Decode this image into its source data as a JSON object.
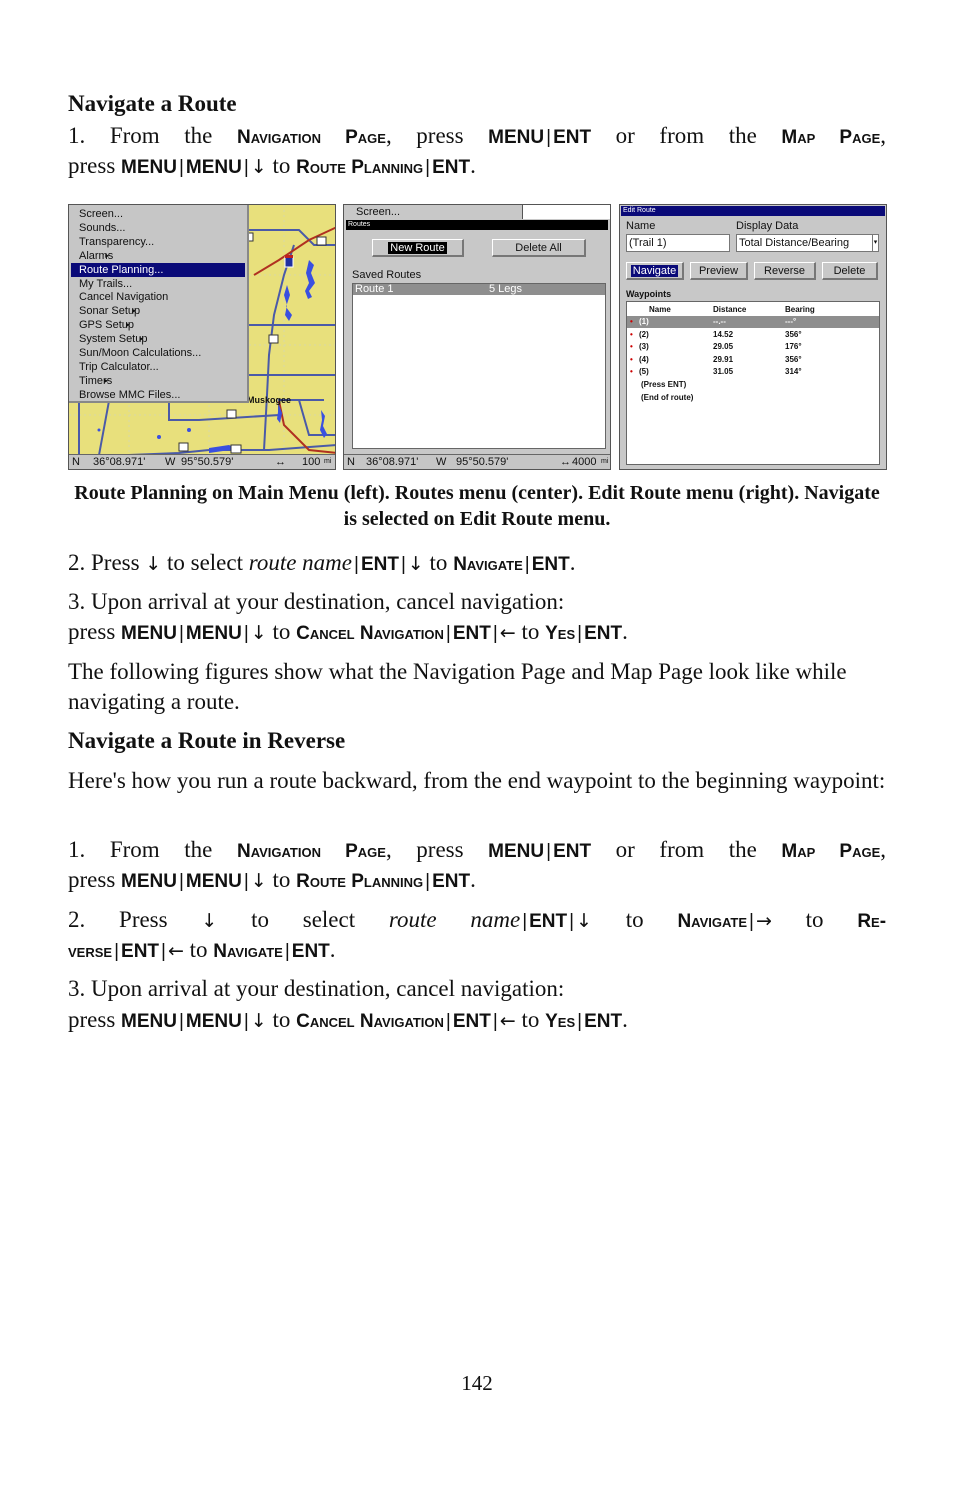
{
  "section1": {
    "heading": "Navigate a Route",
    "step1": {
      "num": "1. From the",
      "navpage": "Navigation Page",
      "press": ", press",
      "menu": "MENU",
      "ent": "ENT",
      "or": "or from the",
      "mappage": "Map Page",
      "comma": ",",
      "press2": "press",
      "to": "to",
      "routeplanning": "Route Planning"
    },
    "step2": {
      "num": "2. Press",
      "to_select": "to select",
      "route_name": "route name",
      "to": "to",
      "navigate": "Navigate",
      "ent": "ENT"
    },
    "step3": {
      "line1": "3. Upon arrival at your destination, cancel navigation:",
      "press": "press",
      "menu": "MENU",
      "to": "to",
      "cancel": "Cancel Navigation",
      "ent": "ENT",
      "yes": "Yes"
    },
    "following": "The following figures show what the Navigation Page and Map Page look like while navigating a route."
  },
  "caption": "Route Planning on Main Menu (left). Routes menu (center). Edit Route menu (right). Navigate is selected on Edit Route menu.",
  "section2": {
    "heading": "Navigate a Route in Reverse",
    "intro": "Here's how you run a route backward, from the end waypoint to the beginning waypoint:",
    "step2": {
      "num": "2. Press",
      "to_select": "to select",
      "route_name": "route name",
      "to": "to",
      "navigate": "Navigate",
      "reverse_a": "Re-",
      "reverse_b": "verse",
      "ent": "ENT"
    }
  },
  "keys": {
    "down": "↓",
    "left": "←",
    "right": "→",
    "sep": "|",
    "period": "."
  },
  "screen1": {
    "menu_items": [
      {
        "label": "Screen...",
        "submenu": false
      },
      {
        "label": "Sounds...",
        "submenu": false
      },
      {
        "label": "Transparency...",
        "submenu": false
      },
      {
        "label": "Alarms",
        "submenu": true
      },
      {
        "label": "Route Planning...",
        "submenu": false,
        "selected": true
      },
      {
        "label": "My Trails...",
        "submenu": false
      },
      {
        "label": "Cancel Navigation",
        "submenu": false
      },
      {
        "label": "Sonar Setup",
        "submenu": true
      },
      {
        "label": "GPS Setup",
        "submenu": true
      },
      {
        "label": "System Setup",
        "submenu": true
      },
      {
        "label": "Sun/Moon Calculations...",
        "submenu": false
      },
      {
        "label": "Trip Calculator...",
        "submenu": false
      },
      {
        "label": "Timers",
        "submenu": true
      },
      {
        "label": "Browse MMC Files...",
        "submenu": false
      }
    ],
    "town": "Muskogee",
    "status": {
      "n": "N",
      "lat": "36°08.971'",
      "w": "W",
      "lon": "95°50.579'",
      "zoom_icon": "↔",
      "zoom": "100",
      "unit": "mi"
    }
  },
  "screen2": {
    "top": "Screen...",
    "title": "Routes",
    "new_route": "New Route",
    "delete_all": "Delete All",
    "saved_label": "Saved Routes",
    "routes": [
      {
        "name": "Route 1",
        "legs": "5 Legs"
      }
    ],
    "status": {
      "n": "N",
      "lat": "36°08.971'",
      "w": "W",
      "lon": "95°50.579'",
      "zoom_icon": "↔",
      "zoom": "4000",
      "unit": "mi"
    }
  },
  "screen3": {
    "title": "Edit Route",
    "name_label": "Name",
    "name_value": "(Trail 1)",
    "display_label": "Display Data",
    "display_value": "Total Distance/Bearing",
    "buttons": {
      "navigate": "Navigate",
      "preview": "Preview",
      "reverse": "Reverse",
      "delete": "Delete"
    },
    "waypoints_label": "Waypoints",
    "columns": [
      "Name",
      "Distance",
      "Bearing"
    ],
    "waypoints": [
      {
        "name": "(1)",
        "distance": "--.--",
        "bearing": "---°"
      },
      {
        "name": "(2)",
        "distance": "14.52",
        "bearing": "356°"
      },
      {
        "name": "(3)",
        "distance": "29.05",
        "bearing": "176°"
      },
      {
        "name": "(4)",
        "distance": "29.91",
        "bearing": "356°"
      },
      {
        "name": "(5)",
        "distance": "31.05",
        "bearing": "314°"
      }
    ],
    "press_ent": "(Press ENT)",
    "end_of_route": "(End of route)"
  },
  "page_number": "142"
}
